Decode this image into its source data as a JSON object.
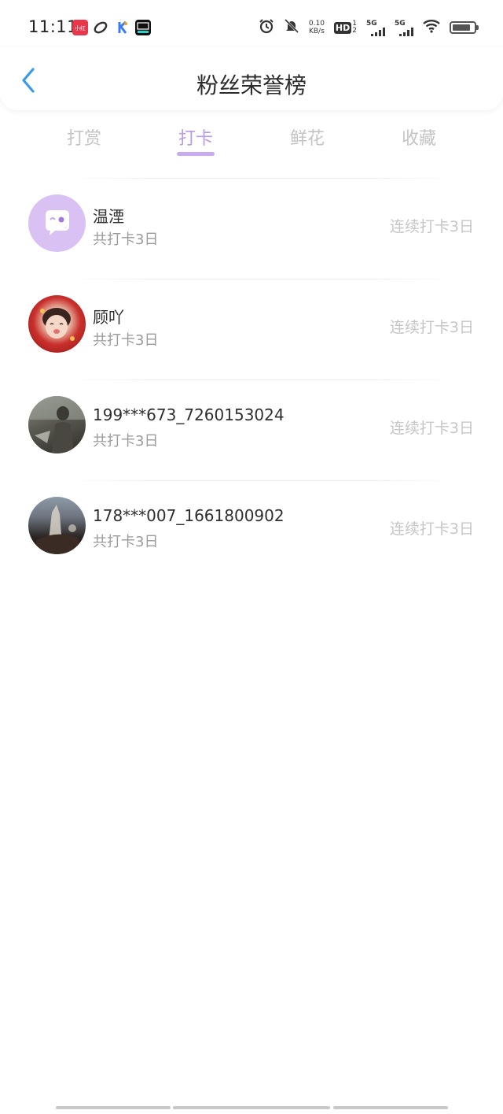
{
  "status_bar": {
    "time": "11:11",
    "net_speed_value": "0.10",
    "net_speed_unit": "KB/s",
    "hd_label": "HD",
    "hd_sup": "1",
    "hd_sub": "2",
    "sim1_label": "5G",
    "sim2_label": "5G",
    "battery_level": 0.85,
    "app_icons": [
      "xiaohongshu-app-icon",
      "link-app-icon",
      "kuaishou-app-icon",
      "douyin-app-icon"
    ],
    "indicator_icons": [
      "alarm-icon",
      "mute-icon",
      "wifi-icon",
      "battery-icon"
    ]
  },
  "header": {
    "title": "粉丝荣誉榜",
    "back_icon": "chevron-left-icon",
    "accent_color": "#3a9ae8"
  },
  "tabs": [
    {
      "label": "打赏",
      "active": false
    },
    {
      "label": "打卡",
      "active": true
    },
    {
      "label": "鲜花",
      "active": false
    },
    {
      "label": "收藏",
      "active": false
    }
  ],
  "tab_active_color": "#b99be4",
  "fans": [
    {
      "name": "温湮",
      "total": "共打卡3日",
      "streak": "连续打卡3日",
      "avatar": "default-chat-avatar"
    },
    {
      "name": "顾吖",
      "total": "共打卡3日",
      "streak": "连续打卡3日",
      "avatar": "photo-avatar-red"
    },
    {
      "name": "199***673_7260153024",
      "total": "共打卡3日",
      "streak": "连续打卡3日",
      "avatar": "photo-avatar-gray"
    },
    {
      "name": "178***007_1661800902",
      "total": "共打卡3日",
      "streak": "连续打卡3日",
      "avatar": "photo-avatar-dark"
    }
  ]
}
